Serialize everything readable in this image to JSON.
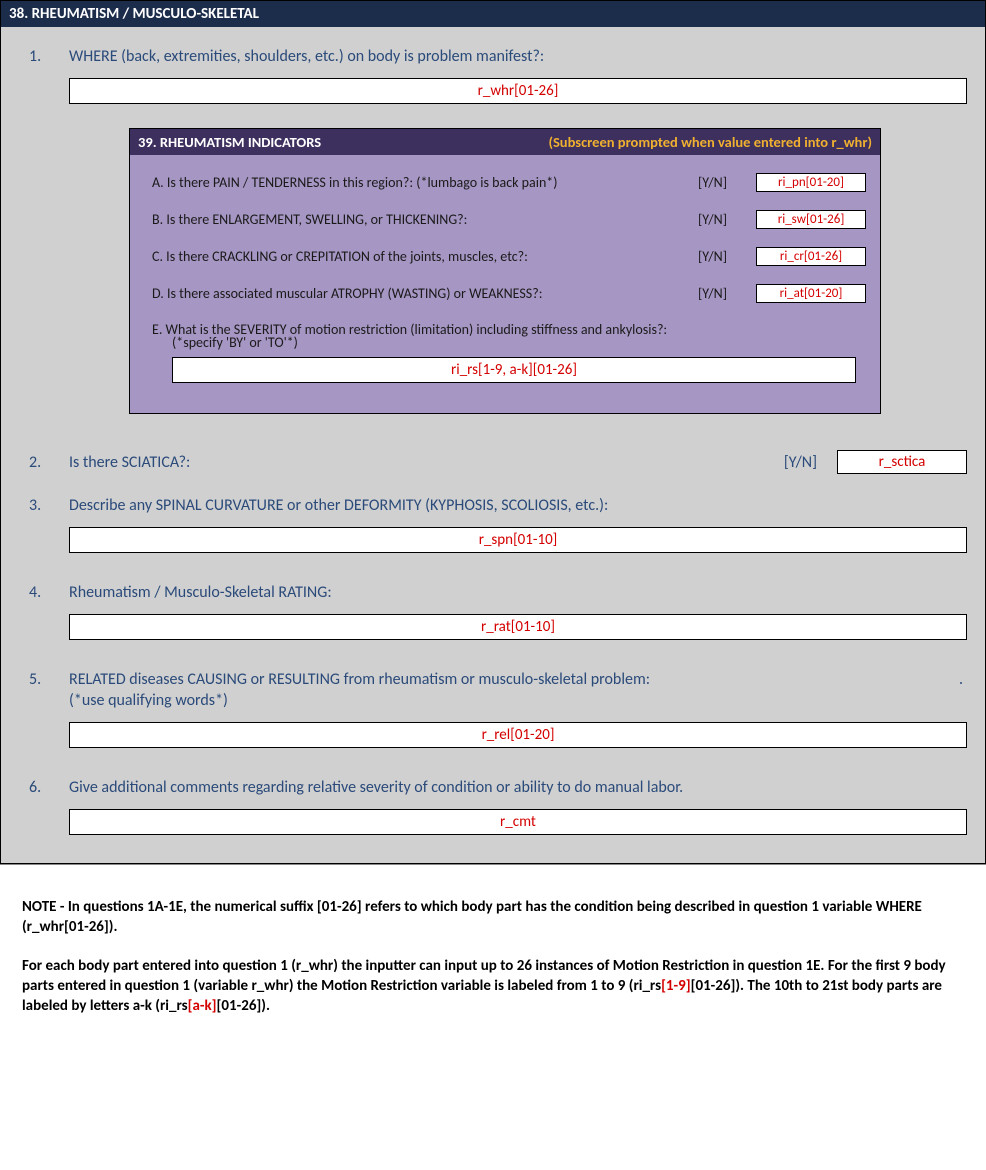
{
  "header": "38. RHEUMATISM / MUSCULO-SKELETAL",
  "q1": {
    "num": "1.",
    "label": "WHERE (back, extremities, shoulders, etc.) on body is problem manifest?:",
    "ans": "r_whr[01-26]"
  },
  "subpanel": {
    "title": "39. RHEUMATISM INDICATORS",
    "subtitle": "(Subscreen prompted when value entered into r_whr)",
    "a": {
      "label": "A. Is there PAIN / TENDERNESS in this region?: (*lumbago is back pain*)",
      "yn": "[Y/N]",
      "ans": "ri_pn[01-20]"
    },
    "b": {
      "label": "B. Is there ENLARGEMENT, SWELLING, or THICKENING?:",
      "yn": "[Y/N]",
      "ans": "ri_sw[01-26]"
    },
    "c": {
      "label": "C. Is there CRACKLING or CREPITATION of the joints, muscles, etc?:",
      "yn": "[Y/N]",
      "ans": "ri_cr[01-26]"
    },
    "d": {
      "label": "D. Is there associated muscular ATROPHY (WASTING) or WEAKNESS?:",
      "yn": "[Y/N]",
      "ans": "ri_at[01-20]"
    },
    "e": {
      "label": "E. What is the SEVERITY of motion restriction (limitation) including stiffness and ankylosis?:",
      "note": "(*specify 'BY' or 'TO'*)",
      "ans": "ri_rs[1-9, a-k][01-26]"
    }
  },
  "q2": {
    "num": "2.",
    "label": "Is there SCIATICA?:",
    "yn": "[Y/N]",
    "ans": "r_sctica"
  },
  "q3": {
    "num": "3.",
    "label": "Describe any SPINAL CURVATURE or other DEFORMITY (KYPHOSIS, SCOLIOSIS, etc.):",
    "ans": "r_spn[01-10]"
  },
  "q4": {
    "num": "4.",
    "label": "Rheumatism / Musculo-Skeletal RATING:",
    "ans": "r_rat[01-10]"
  },
  "q5": {
    "num": "5.",
    "label": "RELATED diseases CAUSING or RESULTING from rheumatism or musculo-skeletal problem:",
    "dot": ".",
    "note": "(*use qualifying words*)",
    "ans": "r_rel[01-20]"
  },
  "q6": {
    "num": "6.",
    "label": "Give additional comments regarding relative severity of condition or ability to do manual labor.",
    "ans": "r_cmt"
  },
  "notes": {
    "p1a": "NOTE - In questions 1A-1E, the numerical suffix [01-26] refers to which body part has the condition being described in question 1 variable WHERE (r_whr[01-26]).",
    "p2a": "For each body part entered into question 1 (r_whr) the inputter can input up to 26 instances of Motion Restriction in question 1E. For the first 9 body parts entered in question 1 (variable r_whr) the Motion Restriction variable is labeled from 1 to 9 (ri_rs",
    "p2red1": "[1-9]",
    "p2b": "[01-26]). The 10th to 21st body parts are labeled by letters a-k (ri_rs",
    "p2red2": "[a-k]",
    "p2c": "[01-26])."
  }
}
